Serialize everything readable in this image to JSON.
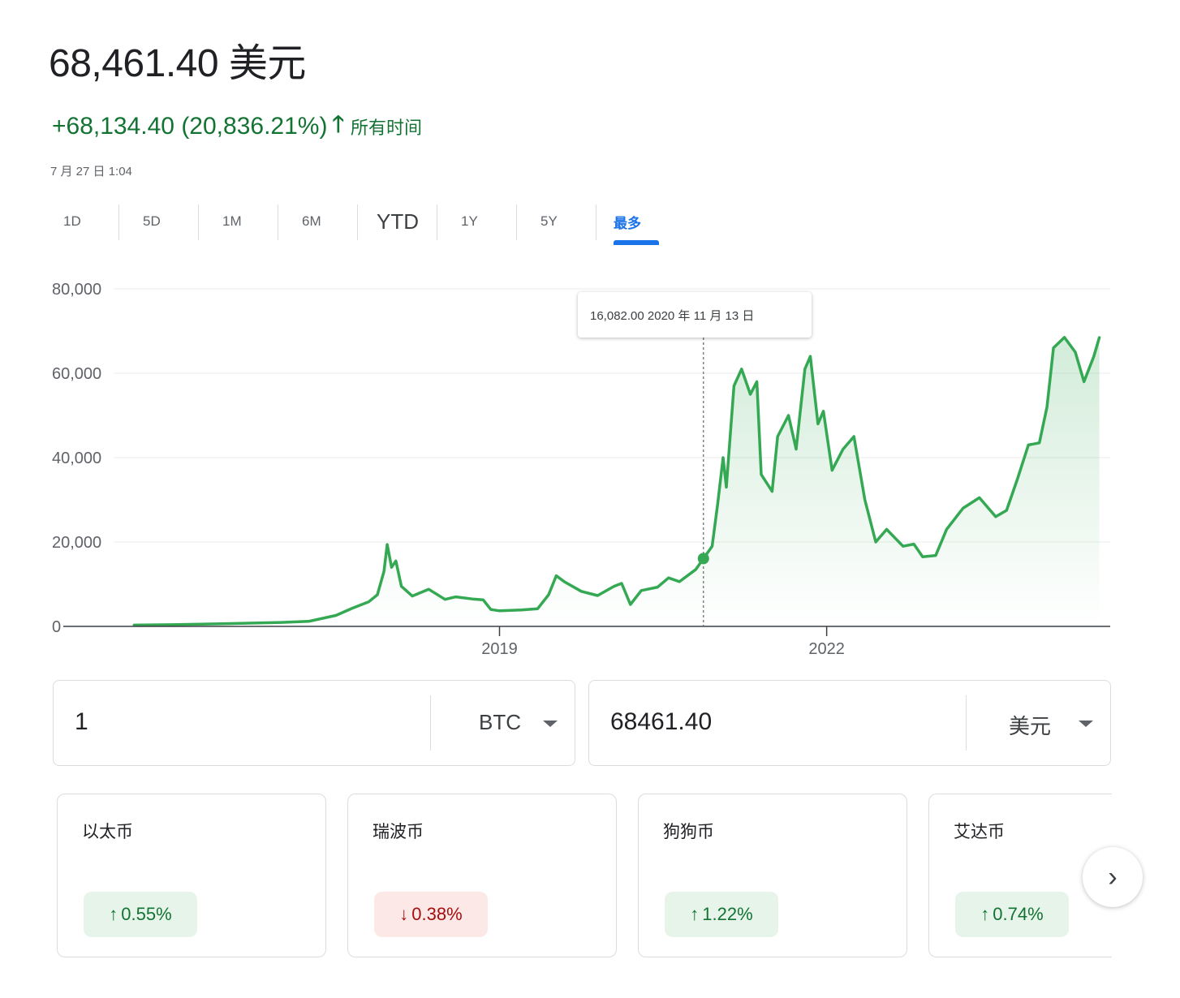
{
  "header": {
    "price": "68,461.40 美元",
    "change": "+68,134.40 (20,836.21%)",
    "change_arrow": "🡑",
    "period": "所有时间",
    "timestamp": "7 月 27 日 1:04"
  },
  "tabs": [
    {
      "label": "1D",
      "active": false
    },
    {
      "label": "5D",
      "active": false
    },
    {
      "label": "1M",
      "active": false
    },
    {
      "label": "6M",
      "active": false
    },
    {
      "label": "YTD",
      "active": false
    },
    {
      "label": "1Y",
      "active": false
    },
    {
      "label": "5Y",
      "active": false
    },
    {
      "label": "最多",
      "active": true
    }
  ],
  "tooltip": {
    "text": "16,082.00 2020 年 11 月 13 日",
    "x": 2020.87,
    "y": 16082
  },
  "chart_data": {
    "type": "area",
    "title": "",
    "xlabel": "",
    "ylabel": "",
    "xlim": [
      2015.0,
      2024.6
    ],
    "ylim": [
      0,
      80000
    ],
    "yticks": [
      {
        "value": 0,
        "label": "0"
      },
      {
        "value": 20000,
        "label": "20,000"
      },
      {
        "value": 40000,
        "label": "40,000"
      },
      {
        "value": 60000,
        "label": "60,000"
      },
      {
        "value": 80000,
        "label": "80,000"
      }
    ],
    "xticks": [
      {
        "value": 2019.0,
        "label": "2019"
      },
      {
        "value": 2022.0,
        "label": "2022"
      }
    ],
    "grid": true,
    "color": "#34a853",
    "series": [
      {
        "points": [
          [
            2015.65,
            300
          ],
          [
            2016.0,
            400
          ],
          [
            2016.5,
            650
          ],
          [
            2017.0,
            950
          ],
          [
            2017.25,
            1200
          ],
          [
            2017.5,
            2600
          ],
          [
            2017.65,
            4300
          ],
          [
            2017.8,
            5800
          ],
          [
            2017.88,
            7500
          ],
          [
            2017.94,
            13000
          ],
          [
            2017.97,
            19400
          ],
          [
            2018.01,
            14000
          ],
          [
            2018.05,
            15500
          ],
          [
            2018.1,
            9500
          ],
          [
            2018.2,
            7200
          ],
          [
            2018.35,
            8800
          ],
          [
            2018.5,
            6400
          ],
          [
            2018.6,
            7000
          ],
          [
            2018.75,
            6500
          ],
          [
            2018.85,
            6300
          ],
          [
            2018.92,
            4000
          ],
          [
            2019.0,
            3700
          ],
          [
            2019.2,
            3900
          ],
          [
            2019.35,
            4200
          ],
          [
            2019.45,
            7500
          ],
          [
            2019.52,
            12000
          ],
          [
            2019.6,
            10500
          ],
          [
            2019.75,
            8300
          ],
          [
            2019.9,
            7300
          ],
          [
            2020.05,
            9500
          ],
          [
            2020.12,
            10200
          ],
          [
            2020.2,
            5200
          ],
          [
            2020.3,
            8500
          ],
          [
            2020.45,
            9300
          ],
          [
            2020.55,
            11500
          ],
          [
            2020.65,
            10600
          ],
          [
            2020.8,
            13500
          ],
          [
            2020.87,
            16082
          ],
          [
            2020.95,
            19000
          ],
          [
            2021.0,
            29000
          ],
          [
            2021.05,
            40000
          ],
          [
            2021.08,
            33000
          ],
          [
            2021.15,
            57000
          ],
          [
            2021.22,
            61000
          ],
          [
            2021.3,
            55000
          ],
          [
            2021.36,
            58000
          ],
          [
            2021.4,
            36000
          ],
          [
            2021.5,
            32000
          ],
          [
            2021.55,
            45000
          ],
          [
            2021.65,
            50000
          ],
          [
            2021.72,
            42000
          ],
          [
            2021.8,
            61000
          ],
          [
            2021.85,
            64000
          ],
          [
            2021.92,
            48000
          ],
          [
            2021.97,
            51000
          ],
          [
            2022.05,
            37000
          ],
          [
            2022.15,
            42000
          ],
          [
            2022.25,
            45000
          ],
          [
            2022.35,
            30000
          ],
          [
            2022.45,
            20000
          ],
          [
            2022.55,
            23000
          ],
          [
            2022.7,
            19000
          ],
          [
            2022.8,
            19500
          ],
          [
            2022.88,
            16500
          ],
          [
            2023.0,
            16800
          ],
          [
            2023.1,
            23000
          ],
          [
            2023.25,
            28000
          ],
          [
            2023.4,
            30500
          ],
          [
            2023.55,
            26000
          ],
          [
            2023.65,
            27500
          ],
          [
            2023.75,
            35000
          ],
          [
            2023.85,
            43000
          ],
          [
            2023.95,
            43500
          ],
          [
            2024.02,
            52000
          ],
          [
            2024.08,
            66000
          ],
          [
            2024.18,
            68500
          ],
          [
            2024.28,
            65000
          ],
          [
            2024.36,
            58000
          ],
          [
            2024.45,
            64000
          ],
          [
            2024.5,
            68461
          ]
        ]
      }
    ]
  },
  "converter": {
    "left": {
      "value": "1",
      "unit": "BTC"
    },
    "right": {
      "value": "68461.40",
      "unit": "美元"
    }
  },
  "cards": [
    {
      "name": "以太币",
      "change": "0.55%",
      "arrow": "↑",
      "direction": "up"
    },
    {
      "name": "瑞波币",
      "change": "0.38%",
      "arrow": "↓",
      "direction": "down"
    },
    {
      "name": "狗狗币",
      "change": "1.22%",
      "arrow": "↑",
      "direction": "up"
    },
    {
      "name": "艾达币",
      "change": "0.74%",
      "arrow": "↑",
      "direction": "up"
    }
  ],
  "next_icon": "›"
}
